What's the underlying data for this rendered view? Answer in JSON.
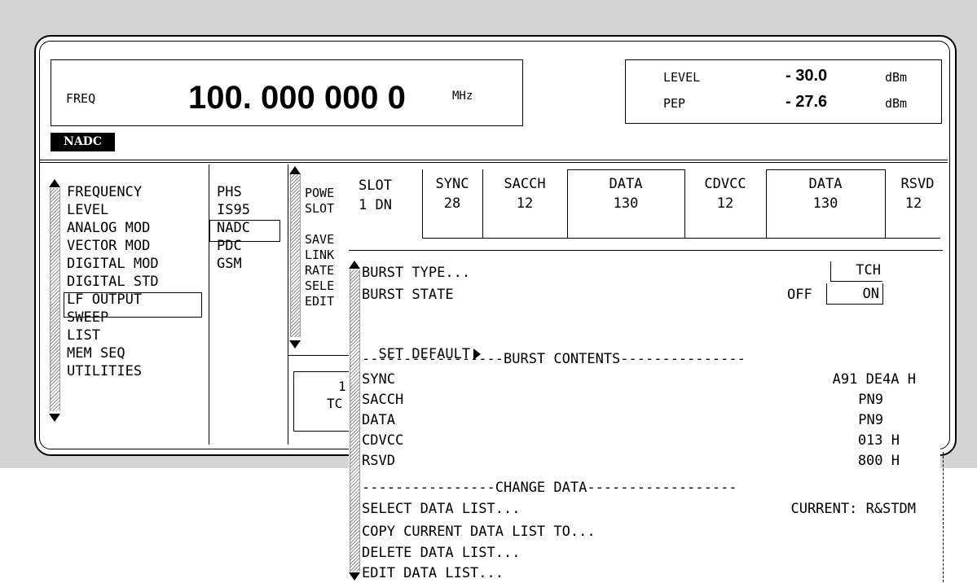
{
  "header": {
    "freq_label": "FREQ",
    "freq_value": "100. 000 000 0",
    "freq_unit": "MHz",
    "level_label": "LEVEL",
    "level_value": "- 30.0",
    "level_unit": "dBm",
    "pep_label": "PEP",
    "pep_value": "- 27.6",
    "pep_unit": "dBm",
    "status_badge": "NADC"
  },
  "menu1": [
    "FREQUENCY",
    "LEVEL",
    "ANALOG MOD",
    "VECTOR MOD",
    "DIGITAL MOD",
    "DIGITAL STD",
    "LF OUTPUT",
    "SWEEP",
    "LIST",
    "MEM SEQ",
    "UTILITIES"
  ],
  "menu1_selected": "DIGITAL STD",
  "menu2": [
    "PHS",
    "IS95",
    "NADC",
    "PDC",
    "GSM"
  ],
  "menu2_selected": "NADC",
  "menu3": [
    "POWE",
    "SLOT",
    "",
    "SAVE",
    "LINK",
    "RATE",
    "SELE",
    "EDIT"
  ],
  "menu3_box": [
    "1",
    "TC"
  ],
  "slot_table": {
    "slot_label": "SLOT",
    "slot_id": "1 DN",
    "fields": [
      {
        "name": "SYNC",
        "bits": "28"
      },
      {
        "name": "SACCH",
        "bits": "12"
      },
      {
        "name": "DATA",
        "bits": "130"
      },
      {
        "name": "CDVCC",
        "bits": "12"
      },
      {
        "name": "DATA",
        "bits": "130"
      },
      {
        "name": "RSVD",
        "bits": "12"
      }
    ]
  },
  "editor": {
    "burst_type_label": "BURST TYPE...",
    "burst_type_value": "TCH",
    "burst_state_label": "BURST STATE",
    "burst_state_off": "OFF",
    "burst_state_on": "ON",
    "set_default": "SET DEFAULT",
    "burst_contents_header": "-----------------BURST CONTENTS---------------",
    "contents": [
      {
        "name": "SYNC",
        "value": "A91 DE4A H"
      },
      {
        "name": "SACCH",
        "value": "PN9"
      },
      {
        "name": "DATA",
        "value": "PN9"
      },
      {
        "name": "CDVCC",
        "value": "013 H"
      },
      {
        "name": "RSVD",
        "value": "800 H"
      }
    ],
    "change_data_header": "----------------CHANGE DATA------------------",
    "select_data_list": "SELECT DATA LIST...",
    "current_label": "CURRENT: R&STDM",
    "copy_data_list": "COPY CURRENT DATA LIST TO...",
    "delete_data_list": "DELETE DATA LIST...",
    "edit_data_list": "EDIT DATA LIST..."
  }
}
